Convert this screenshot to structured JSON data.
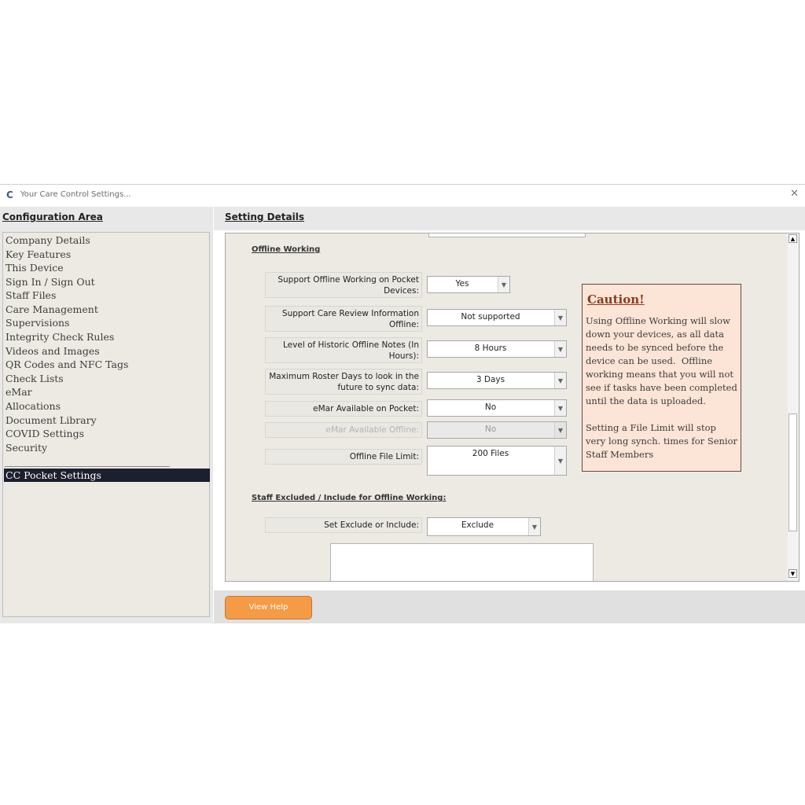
{
  "window": {
    "title": "Your Care Control Settings...",
    "logo_glyph": "C",
    "close_glyph": "✕"
  },
  "left": {
    "title": "Configuration Area",
    "items": [
      {
        "label": "Company Details"
      },
      {
        "label": "Key Features"
      },
      {
        "label": "This Device"
      },
      {
        "label": "Sign In / Sign Out"
      },
      {
        "label": "Staff Files"
      },
      {
        "label": "Care Management"
      },
      {
        "label": "Supervisions"
      },
      {
        "label": "Integrity Check Rules"
      },
      {
        "label": "Videos and Images"
      },
      {
        "label": "QR Codes and NFC Tags"
      },
      {
        "label": "Check Lists"
      },
      {
        "label": "eMar"
      },
      {
        "label": "Allocations"
      },
      {
        "label": "Document Library"
      },
      {
        "label": "COVID Settings"
      },
      {
        "label": "Security"
      },
      {
        "label": "CC Pocket Settings",
        "selected": true
      }
    ]
  },
  "details": {
    "title": "Setting Details",
    "section_offline": "Offline Working",
    "fields": [
      {
        "label": "Support Offline Working on Pocket Devices:",
        "value": "Yes"
      },
      {
        "label": "Support Care Review Information Offline:",
        "value": "Not supported"
      },
      {
        "label": "Level of Historic Offline Notes (In Hours):",
        "value": "8 Hours"
      },
      {
        "label": "Maximum Roster Days to look in the future to sync data:",
        "value": "3 Days"
      },
      {
        "label": "eMar Available on Pocket:",
        "value": "No"
      },
      {
        "label": "eMar Available Offline:",
        "value": "No",
        "disabled": true
      },
      {
        "label": "Offline File Limit:",
        "value": "200 Files"
      }
    ],
    "section_staff": "Staff Excluded / Include for Offline Working:",
    "exclude_field": {
      "label": "Set Exclude or Include:",
      "value": "Exclude"
    },
    "caution": {
      "title": "Caution!",
      "body": "Using Offline Working will slow down your devices, as all data needs to be synced before the device can be used.  Offline working means that you will not see if tasks have been completed until the data is uploaded.\n\nSetting a File Limit will stop very long synch. times for Senior Staff Members"
    },
    "icons": {
      "dropdown": "chevron-down-icon",
      "scroll_up": "arrow-up-icon",
      "scroll_down": "arrow-down-icon"
    }
  },
  "footer": {
    "help_label": "View Help"
  },
  "colors": {
    "accent": "#f59a45",
    "caution_bg": "#fce4d6",
    "selected_bg": "#1b1f2e"
  }
}
